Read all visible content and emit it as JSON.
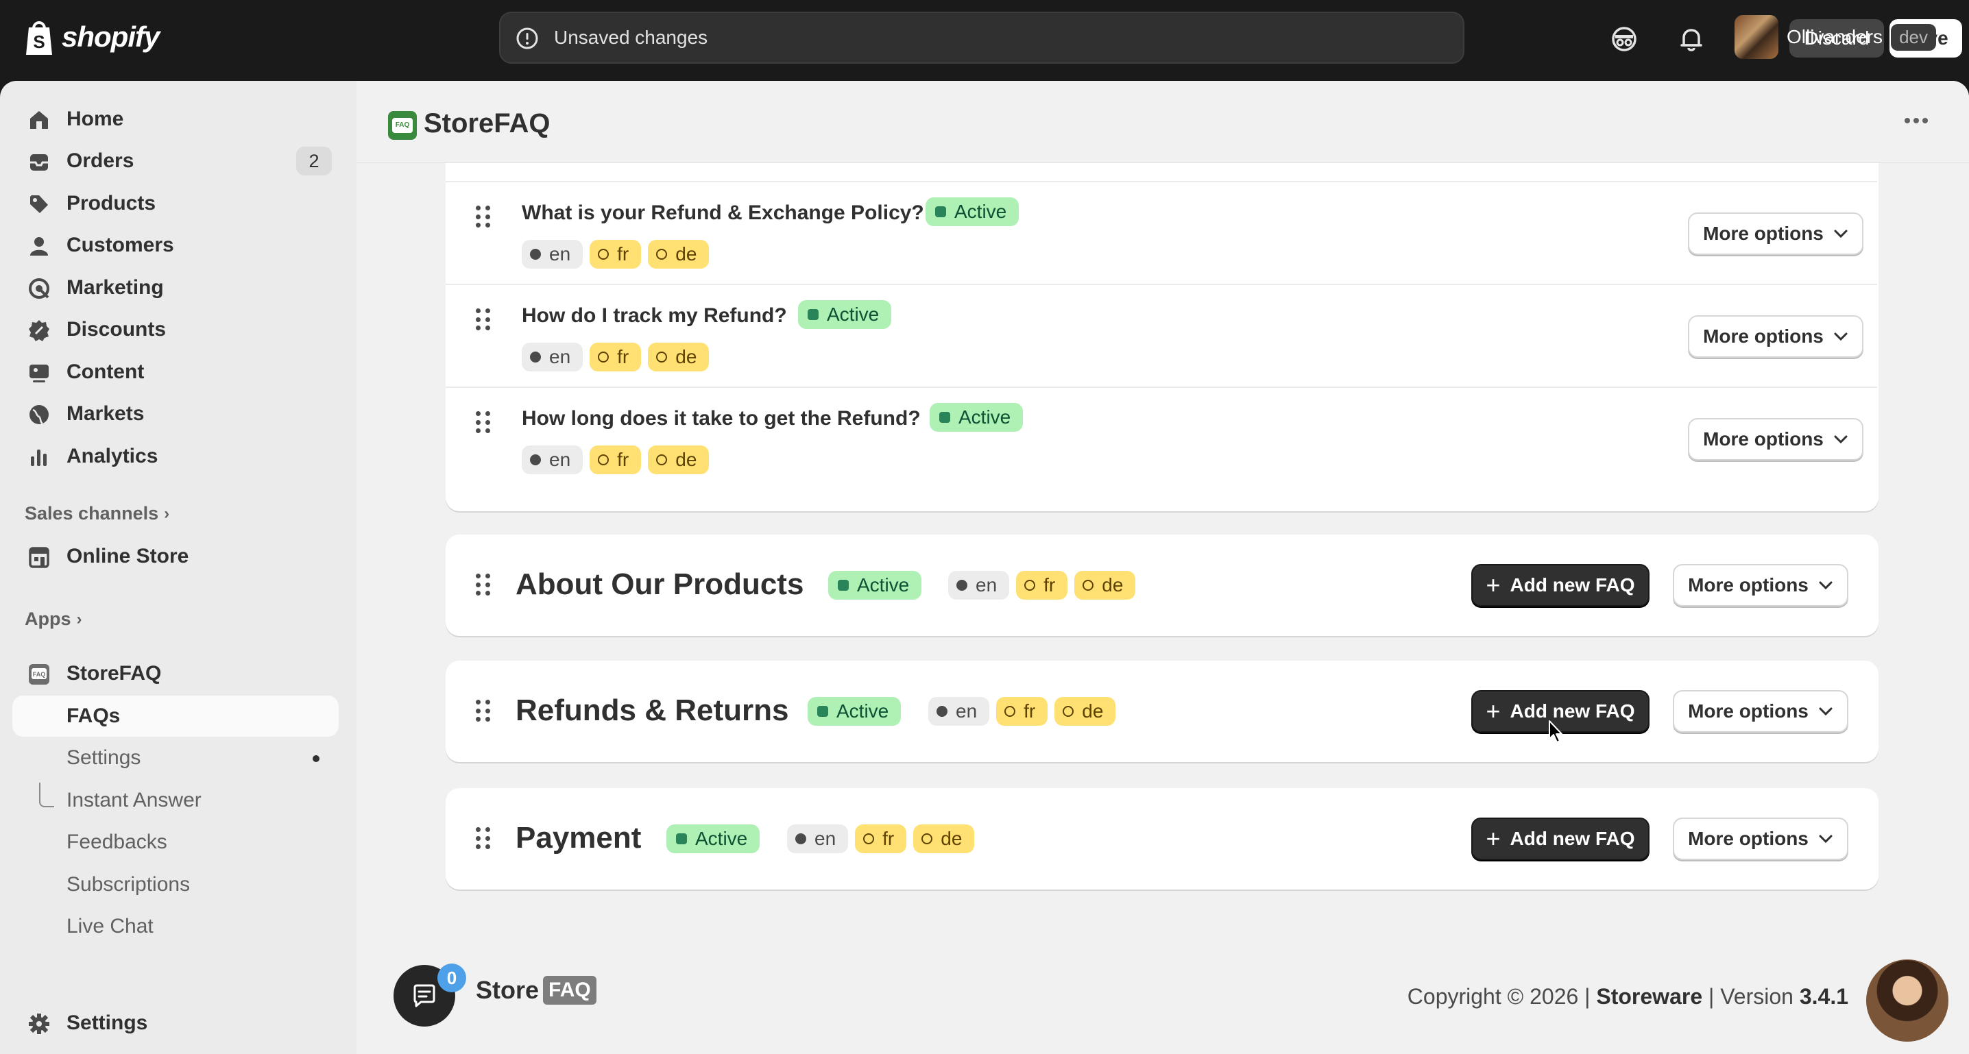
{
  "topbar": {
    "brand": "shopify",
    "unsaved_text": "Unsaved changes",
    "discard_label": "Discard",
    "save_label": "Save",
    "store_name": "Ollivanders",
    "store_badge": "dev"
  },
  "sidebar": {
    "main_items": [
      {
        "label": "Home",
        "icon": "home-icon"
      },
      {
        "label": "Orders",
        "icon": "orders-icon",
        "badge": "2"
      },
      {
        "label": "Products",
        "icon": "tag-icon"
      },
      {
        "label": "Customers",
        "icon": "person-icon"
      },
      {
        "label": "Marketing",
        "icon": "target-icon"
      },
      {
        "label": "Discounts",
        "icon": "discount-icon"
      },
      {
        "label": "Content",
        "icon": "content-icon"
      },
      {
        "label": "Markets",
        "icon": "globe-icon"
      },
      {
        "label": "Analytics",
        "icon": "bar-chart-icon"
      }
    ],
    "sales_channels_label": "Sales channels",
    "online_store_label": "Online Store",
    "apps_label": "Apps",
    "app_name": "StoreFAQ",
    "app_sub_items": [
      "FAQs",
      "Settings",
      "Instant Answer",
      "Feedbacks",
      "Subscriptions",
      "Live Chat"
    ],
    "settings_label": "Settings"
  },
  "app_header": {
    "title": "StoreFAQ",
    "logo_text": "FAQ"
  },
  "faqs": [
    {
      "question": "What is your Refund & Exchange Policy?",
      "status": "Active",
      "langs": [
        "en",
        "fr",
        "de"
      ]
    },
    {
      "question": "How do I track my Refund?",
      "status": "Active",
      "langs": [
        "en",
        "fr",
        "de"
      ]
    },
    {
      "question": "How long does it take to get the Refund?",
      "status": "Active",
      "langs": [
        "en",
        "fr",
        "de"
      ]
    }
  ],
  "categories": [
    {
      "title": "About Our Products",
      "status": "Active",
      "langs": [
        "en",
        "fr",
        "de"
      ]
    },
    {
      "title": "Refunds & Returns",
      "status": "Active",
      "langs": [
        "en",
        "fr",
        "de"
      ]
    },
    {
      "title": "Payment",
      "status": "Active",
      "langs": [
        "en",
        "fr",
        "de"
      ]
    }
  ],
  "buttons": {
    "more_options": "More options",
    "add_new_faq": "Add new FAQ"
  },
  "footer": {
    "chat_count": "0",
    "logo_store": "Store",
    "logo_faq": "FAQ",
    "copyright_prefix": "Copyright © 2026 |",
    "company": "Storeware",
    "version_prefix": "| Version",
    "version": "3.4.1"
  }
}
